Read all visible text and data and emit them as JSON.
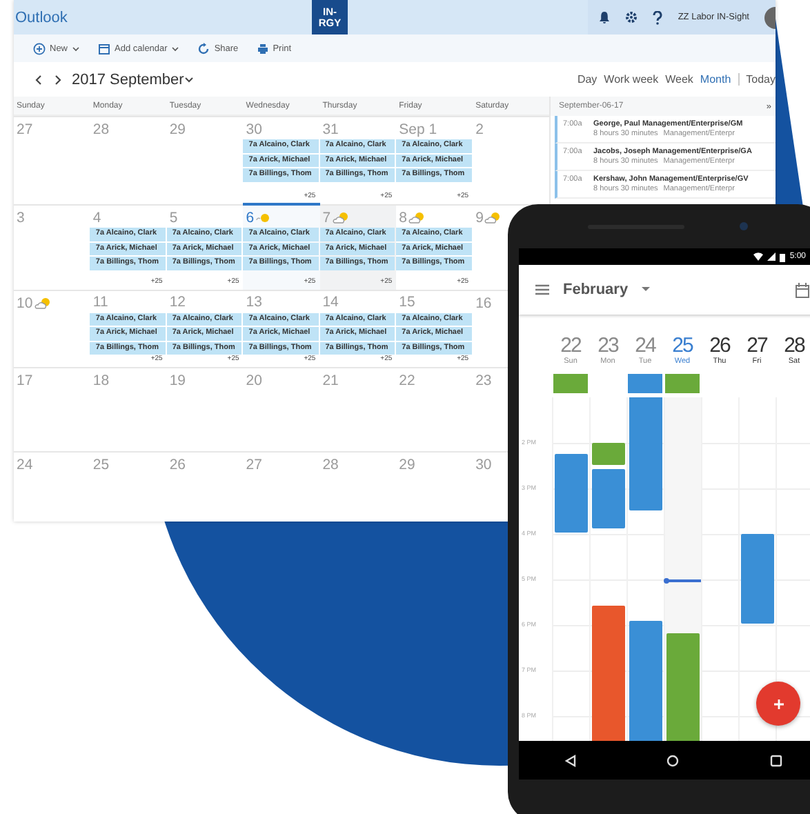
{
  "outlook": {
    "app_title": "Outlook",
    "logo": [
      "IN-",
      "RGY"
    ],
    "user": "ZZ Labor IN-Sight",
    "toolbar": [
      {
        "kind": "new",
        "label": "New"
      },
      {
        "kind": "add",
        "label": "Add calendar"
      },
      {
        "kind": "share",
        "label": "Share"
      },
      {
        "kind": "print",
        "label": "Print"
      }
    ],
    "month_title": "2017 September",
    "views": [
      {
        "label": "Day",
        "selected": false
      },
      {
        "label": "Work week",
        "selected": false
      },
      {
        "label": "Week",
        "selected": false
      },
      {
        "label": "Month",
        "selected": true
      }
    ],
    "today_button": "Today",
    "weekdays": [
      "Sunday",
      "Monday",
      "Tuesday",
      "Wednesday",
      "Thursday",
      "Friday",
      "Saturday"
    ],
    "weeks": [
      [
        {
          "date": "27"
        },
        {
          "date": "28"
        },
        {
          "date": "29"
        },
        {
          "date": "30",
          "events": [
            "7a Alcaino, Clark",
            "7a Arick, Michael",
            "7a Billings, Thom"
          ],
          "more": "+25"
        },
        {
          "date": "31",
          "events": [
            "7a Alcaino, Clark",
            "7a Arick, Michael",
            "7a Billings, Thom"
          ],
          "more": "+25"
        },
        {
          "date": "Sep 1",
          "events": [
            "7a Alcaino, Clark",
            "7a Arick, Michael",
            "7a Billings, Thom"
          ],
          "more": "+25"
        },
        {
          "date": "2"
        }
      ],
      [
        {
          "date": "3"
        },
        {
          "date": "4",
          "events": [
            "7a Alcaino, Clark",
            "7a Arick, Michael",
            "7a Billings, Thom"
          ],
          "more": "+25"
        },
        {
          "date": "5",
          "events": [
            "7a Alcaino, Clark",
            "7a Arick, Michael",
            "7a Billings, Thom"
          ],
          "more": "+25"
        },
        {
          "date": "6",
          "today": true,
          "sunny": true,
          "events": [
            "7a Alcaino, Clark",
            "7a Arick, Michael",
            "7a Billings, Thom"
          ],
          "more": "+25"
        },
        {
          "date": "7",
          "selected": true,
          "partly_cloudy": true,
          "events": [
            "7a Alcaino, Clark",
            "7a Arick, Michael",
            "7a Billings, Thom"
          ],
          "more": "+25"
        },
        {
          "date": "8",
          "partly_cloudy": true,
          "events": [
            "7a Alcaino, Clark",
            "7a Arick, Michael",
            "7a Billings, Thom"
          ],
          "more": "+25"
        },
        {
          "date": "9",
          "partly_cloudy": true
        }
      ],
      [
        {
          "date": "10",
          "partly_cloudy": true
        },
        {
          "date": "11",
          "events": [
            "7a Alcaino, Clark",
            "7a Arick, Michael",
            "7a Billings, Thom"
          ],
          "more": "+25"
        },
        {
          "date": "12",
          "events": [
            "7a Alcaino, Clark",
            "7a Arick, Michael",
            "7a Billings, Thom"
          ],
          "more": "+25"
        },
        {
          "date": "13",
          "events": [
            "7a Alcaino, Clark",
            "7a Arick, Michael",
            "7a Billings, Thom"
          ],
          "more": "+25"
        },
        {
          "date": "14",
          "events": [
            "7a Alcaino, Clark",
            "7a Arick, Michael",
            "7a Billings, Thom"
          ],
          "more": "+25"
        },
        {
          "date": "15",
          "events": [
            "7a Alcaino, Clark",
            "7a Arick, Michael",
            "7a Billings, Thom"
          ],
          "more": "+25"
        },
        {
          "date": "16"
        }
      ],
      [
        {
          "date": "17"
        },
        {
          "date": "18"
        },
        {
          "date": "19"
        },
        {
          "date": "20"
        },
        {
          "date": "21"
        },
        {
          "date": "22"
        },
        {
          "date": "23"
        }
      ],
      [
        {
          "date": "24"
        },
        {
          "date": "25"
        },
        {
          "date": "26"
        },
        {
          "date": "27"
        },
        {
          "date": "28"
        },
        {
          "date": "29"
        },
        {
          "date": "30"
        }
      ]
    ],
    "agenda": {
      "date": "September-06-17",
      "collapse": "»",
      "items": [
        {
          "time": "7:00a",
          "title": "George, Paul Management/Enterprise/GM",
          "duration": "8 hours 30 minutes",
          "category": "Management/Enterpr"
        },
        {
          "time": "7:00a",
          "title": "Jacobs, Joseph Management/Enterprise/GA",
          "duration": "8 hours 30 minutes",
          "category": "Management/Enterpr"
        },
        {
          "time": "7:00a",
          "title": "Kershaw, John Management/Enterprise/GV",
          "duration": "8 hours 30 minutes",
          "category": "Management/Enterpr"
        }
      ]
    }
  },
  "phone": {
    "status_time": "5:00",
    "month": "February",
    "hours": [
      "2 PM",
      "3 PM",
      "4 PM",
      "5 PM",
      "6 PM",
      "7 PM",
      "8 PM"
    ],
    "days": [
      {
        "number": "22",
        "weekday": "Sun",
        "past": true,
        "selected": false,
        "all_day": [
          {
            "color": "#6aaa3a"
          }
        ],
        "events": [
          {
            "color": "#3a8fd6"
          }
        ]
      },
      {
        "number": "23",
        "weekday": "Mon",
        "past": true,
        "selected": false,
        "events": [
          {
            "color": "#6aaa3a"
          },
          {
            "color": "#3a8fd6"
          },
          {
            "color": "#e8572c"
          }
        ]
      },
      {
        "number": "24",
        "weekday": "Tue",
        "past": true,
        "selected": false,
        "all_day": [
          {
            "color": "#3a8fd6"
          }
        ],
        "events": [
          {
            "color": "#3a8fd6"
          },
          {
            "color": "#3a8fd6"
          }
        ]
      },
      {
        "number": "25",
        "weekday": "Wed",
        "past": false,
        "selected": true,
        "now_line": true,
        "all_day": [
          {
            "color": "#6aaa3a"
          }
        ],
        "events": [
          {
            "color": "#6aaa3a"
          }
        ]
      },
      {
        "number": "26",
        "weekday": "Thu",
        "past": false,
        "selected": false
      },
      {
        "number": "27",
        "weekday": "Fri",
        "past": false,
        "selected": false,
        "events": [
          {
            "color": "#3a8fd6"
          }
        ]
      },
      {
        "number": "28",
        "weekday": "Sat",
        "past": false,
        "selected": false
      }
    ]
  }
}
